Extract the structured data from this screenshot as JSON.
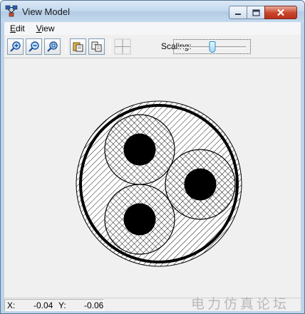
{
  "window": {
    "title": "View Model",
    "app_icon": "network-icon"
  },
  "menu": {
    "items": [
      {
        "label": "Edit",
        "mnemonic": "E"
      },
      {
        "label": "View",
        "mnemonic": "V"
      }
    ]
  },
  "toolbar": {
    "buttons": [
      {
        "name": "zoom-in-icon"
      },
      {
        "name": "zoom-out-icon"
      },
      {
        "name": "zoom-fit-icon"
      },
      {
        "name": "copy-icon"
      },
      {
        "name": "copy-settings-icon"
      },
      {
        "name": "grid-icon"
      }
    ],
    "scaling_label": "Scaling:",
    "scaling_level": 0.5
  },
  "status": {
    "x_label": "X:",
    "x_value": "-0.04",
    "y_label": "Y:",
    "y_value": "-0.06"
  },
  "watermark": "电力仿真论坛",
  "colors": {
    "titlebar": "#c2d8ee",
    "close_button": "#c9442a",
    "canvas": "#f0f0f0",
    "drawing": "#000000"
  }
}
